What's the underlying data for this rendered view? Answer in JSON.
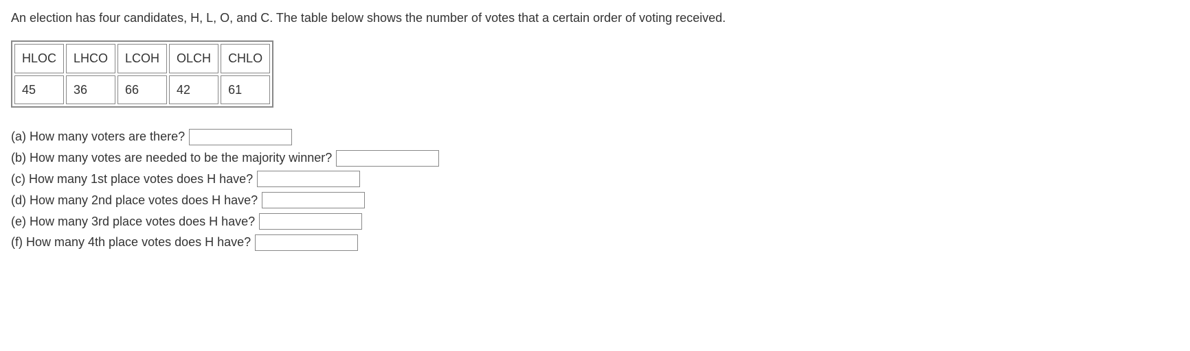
{
  "intro": "An election has four candidates, H, L, O, and C. The table below shows the number of votes that a certain order of voting received.",
  "table": {
    "headers": [
      "HLOC",
      "LHCO",
      "LCOH",
      "OLCH",
      "CHLO"
    ],
    "values": [
      "45",
      "36",
      "66",
      "42",
      "61"
    ]
  },
  "questions": {
    "a": "(a) How many voters are there?",
    "b": "(b) How many votes are needed to be the majority winner?",
    "c": "(c) How many 1st place votes does H have?",
    "d": "(d) How many 2nd place votes does H have?",
    "e": "(e) How many 3rd place votes does H have?",
    "f": "(f) How many 4th place votes does H have?"
  }
}
